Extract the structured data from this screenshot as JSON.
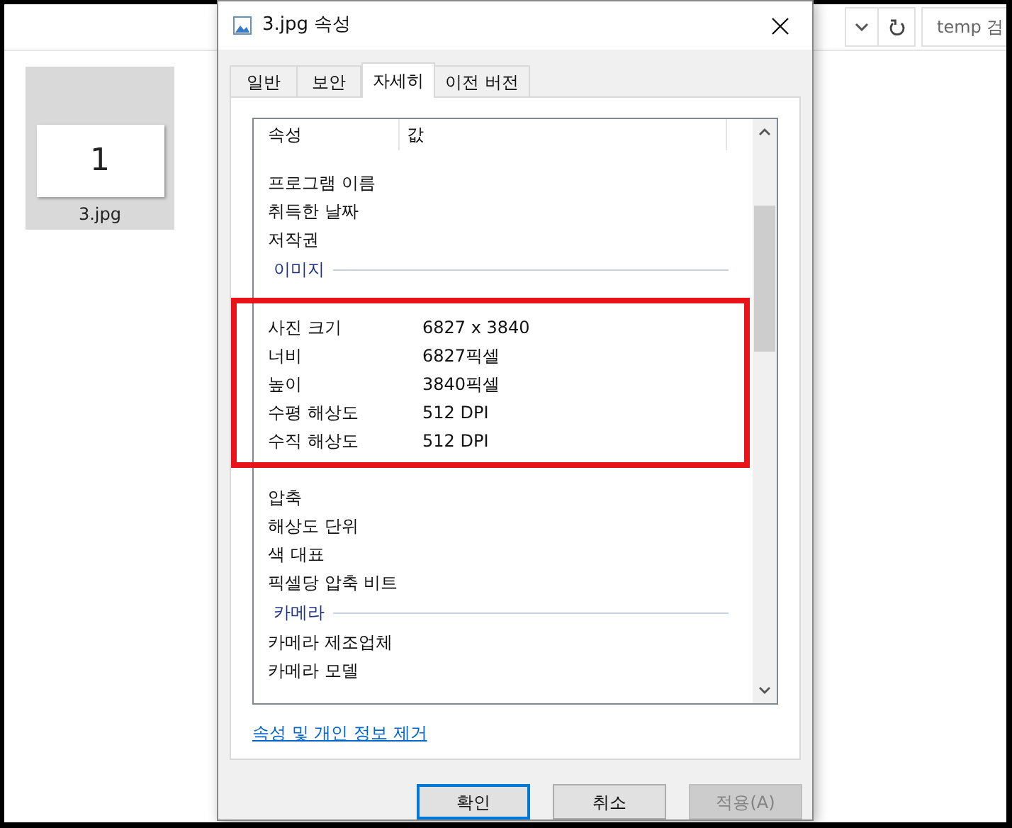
{
  "explorer": {
    "search": {
      "placeholder": "temp 검"
    },
    "file": {
      "thumbnail_text": "1",
      "name": "3.jpg",
      "selected": true
    }
  },
  "dialog": {
    "title": "3.jpg 속성",
    "tabs": [
      {
        "label": "일반",
        "selected": false
      },
      {
        "label": "보안",
        "selected": false
      },
      {
        "label": "자세히",
        "selected": true
      },
      {
        "label": "이전 버전",
        "selected": false
      }
    ],
    "columns": [
      "속성",
      "값"
    ],
    "rows": [
      {
        "kind": "covered"
      },
      {
        "kind": "row",
        "name": "프로그램 이름"
      },
      {
        "kind": "row",
        "name": "취득한 날짜"
      },
      {
        "kind": "row",
        "name": "저작권"
      },
      {
        "kind": "group",
        "name": "이미지"
      },
      {
        "kind": "covered"
      },
      {
        "kind": "row",
        "name": "사진 크기",
        "value": "6827 x 3840"
      },
      {
        "kind": "row",
        "name": "너비",
        "value": "6827픽셀"
      },
      {
        "kind": "row",
        "name": "높이",
        "value": "3840픽셀"
      },
      {
        "kind": "row",
        "name": "수평 해상도",
        "value": "512 DPI"
      },
      {
        "kind": "row",
        "name": "수직 해상도",
        "value": "512 DPI"
      },
      {
        "kind": "covered"
      },
      {
        "kind": "row",
        "name": "압축"
      },
      {
        "kind": "row",
        "name": "해상도 단위"
      },
      {
        "kind": "row",
        "name": "색 대표"
      },
      {
        "kind": "row",
        "name": "픽셀당 압축 비트"
      },
      {
        "kind": "group",
        "name": "카메라"
      },
      {
        "kind": "row",
        "name": "카메라 제조업체"
      },
      {
        "kind": "row",
        "name": "카메라 모델"
      }
    ],
    "link": "속성 및 개인 정보 제거",
    "buttons": [
      {
        "label": "확인",
        "kind": "default",
        "disabled": false
      },
      {
        "label": "취소",
        "kind": "normal",
        "disabled": false
      },
      {
        "label": "적용(A)",
        "kind": "normal",
        "disabled": true
      }
    ]
  }
}
